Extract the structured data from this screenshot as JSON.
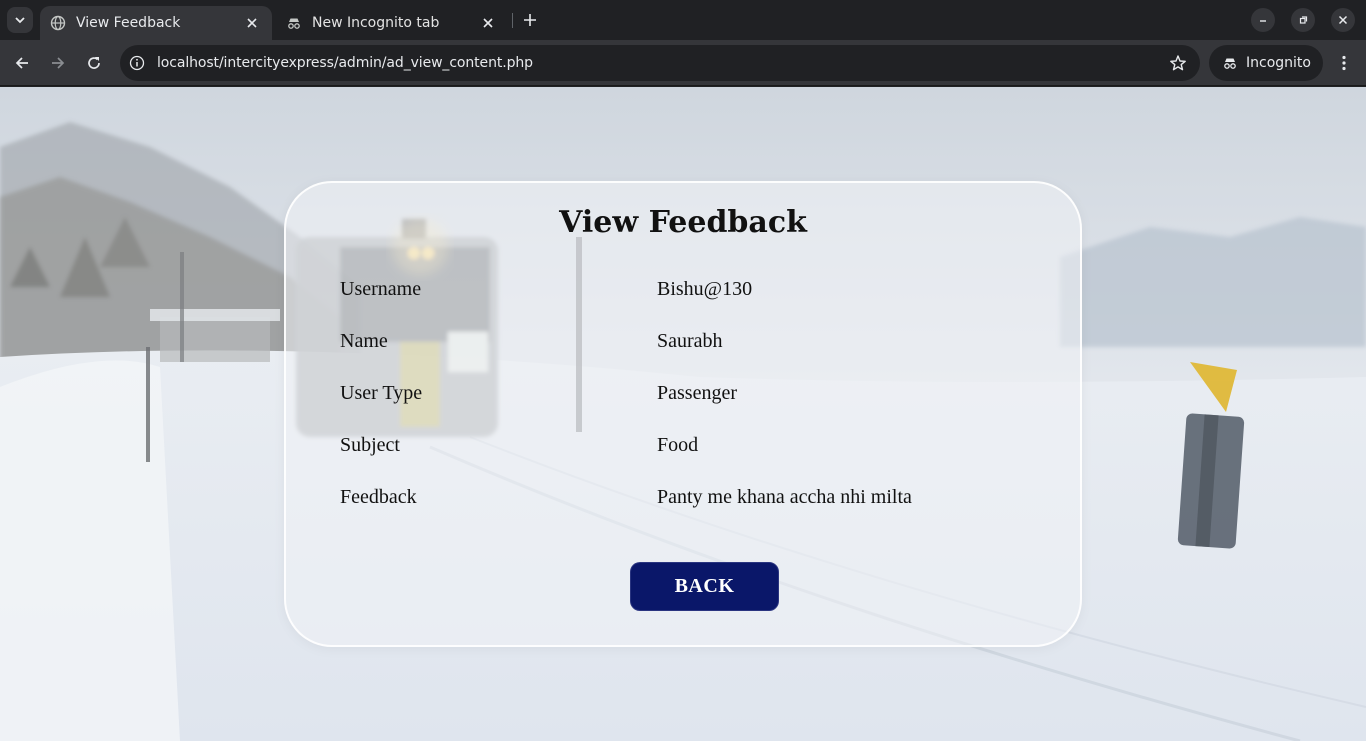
{
  "browser": {
    "tabs": [
      {
        "title": "View Feedback",
        "active": true,
        "icon": "globe-icon"
      },
      {
        "title": "New Incognito tab",
        "active": false,
        "icon": "incognito-icon"
      }
    ],
    "url": "localhost/intercityexpress/admin/ad_view_content.php",
    "profile_label": "Incognito"
  },
  "page": {
    "title": "View Feedback",
    "fields": [
      {
        "label": "Username",
        "value": "Bishu@130"
      },
      {
        "label": "Name",
        "value": "Saurabh"
      },
      {
        "label": "User Type",
        "value": "Passenger"
      },
      {
        "label": "Subject",
        "value": "Food"
      },
      {
        "label": "Feedback",
        "value": "Panty me khana accha nhi milta"
      }
    ],
    "back_label": "BACK",
    "accent_color": "#0a1769"
  }
}
